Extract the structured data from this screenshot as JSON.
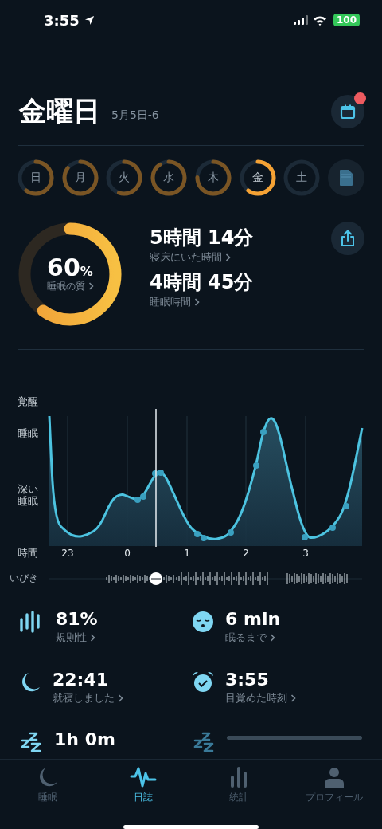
{
  "status_bar": {
    "time": "3:55",
    "battery": "100"
  },
  "header": {
    "title": "金曜日",
    "date": "5月5日-6",
    "has_notification": true
  },
  "days": [
    {
      "label": "日",
      "selected": false
    },
    {
      "label": "月",
      "selected": false
    },
    {
      "label": "火",
      "selected": false
    },
    {
      "label": "水",
      "selected": false
    },
    {
      "label": "木",
      "selected": false
    },
    {
      "label": "金",
      "selected": true
    },
    {
      "label": "土",
      "selected": false
    }
  ],
  "summary": {
    "quality": {
      "value": "60",
      "unit": "%",
      "label": "睡眠の質",
      "level": 0.6
    },
    "metrics": [
      {
        "value": "5時間 14分",
        "label": "寝床にいた時間"
      },
      {
        "value": "4時間 45分",
        "label": "睡眠時間"
      }
    ]
  },
  "chart": {
    "y_labels": [
      "覚醒",
      "睡眠",
      "深い睡眠"
    ],
    "x_title": "時間",
    "x_labels": [
      "23",
      "0",
      "1",
      "2",
      "3"
    ],
    "snore_label": "いびき"
  },
  "stats": [
    {
      "kind": "regularity",
      "value": "81%",
      "label": "規則性"
    },
    {
      "kind": "face",
      "value": "6 min",
      "label": "眠るまで"
    },
    {
      "kind": "moon",
      "value": "22:41",
      "label": "就寝しました"
    },
    {
      "kind": "alarm",
      "value": "3:55",
      "label": "目覚めた時刻"
    },
    {
      "kind": "zzz",
      "value": "1h 0m"
    },
    {
      "kind": "loading"
    }
  ],
  "tabs": [
    {
      "label": "睡眠",
      "selected": false
    },
    {
      "label": "日誌",
      "selected": true
    },
    {
      "label": "統計",
      "selected": false
    },
    {
      "label": "プロフィール",
      "selected": false
    }
  ]
}
